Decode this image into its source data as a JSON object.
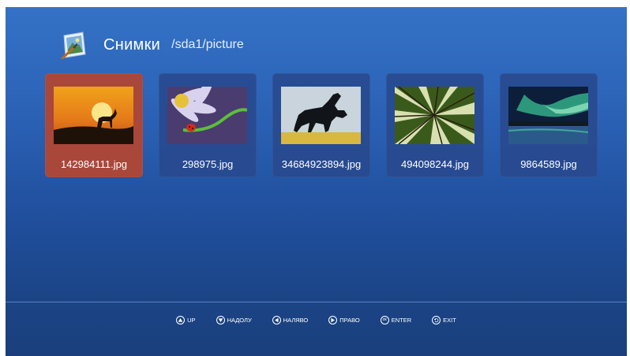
{
  "header": {
    "title": "Снимки",
    "path": "/sda1/picture",
    "icon": "picture-folder-icon"
  },
  "files": [
    {
      "name": "142984111.jpg",
      "selected": true,
      "thumb": "sunset-deer-silhouette"
    },
    {
      "name": "298975.jpg",
      "selected": false,
      "thumb": "ladybug-flower"
    },
    {
      "name": "34684923894.jpg",
      "selected": false,
      "thumb": "black-horse-jumping"
    },
    {
      "name": "494098244.jpg",
      "selected": false,
      "thumb": "forest-canopy"
    },
    {
      "name": "9864589.jpg",
      "selected": false,
      "thumb": "aurora-lake"
    }
  ],
  "footer": {
    "up": "UP",
    "down": "НАДОЛУ",
    "left": "НАЛЯВО",
    "right": "ПРАВО",
    "ok_icon": "ok",
    "enter": "ENTER",
    "exit": "EXIT"
  },
  "colors": {
    "selected_tile": "#a9473a",
    "tile": "#2a4a8e",
    "background_top": "#3472c6",
    "background_bottom": "#1a3f7c"
  }
}
